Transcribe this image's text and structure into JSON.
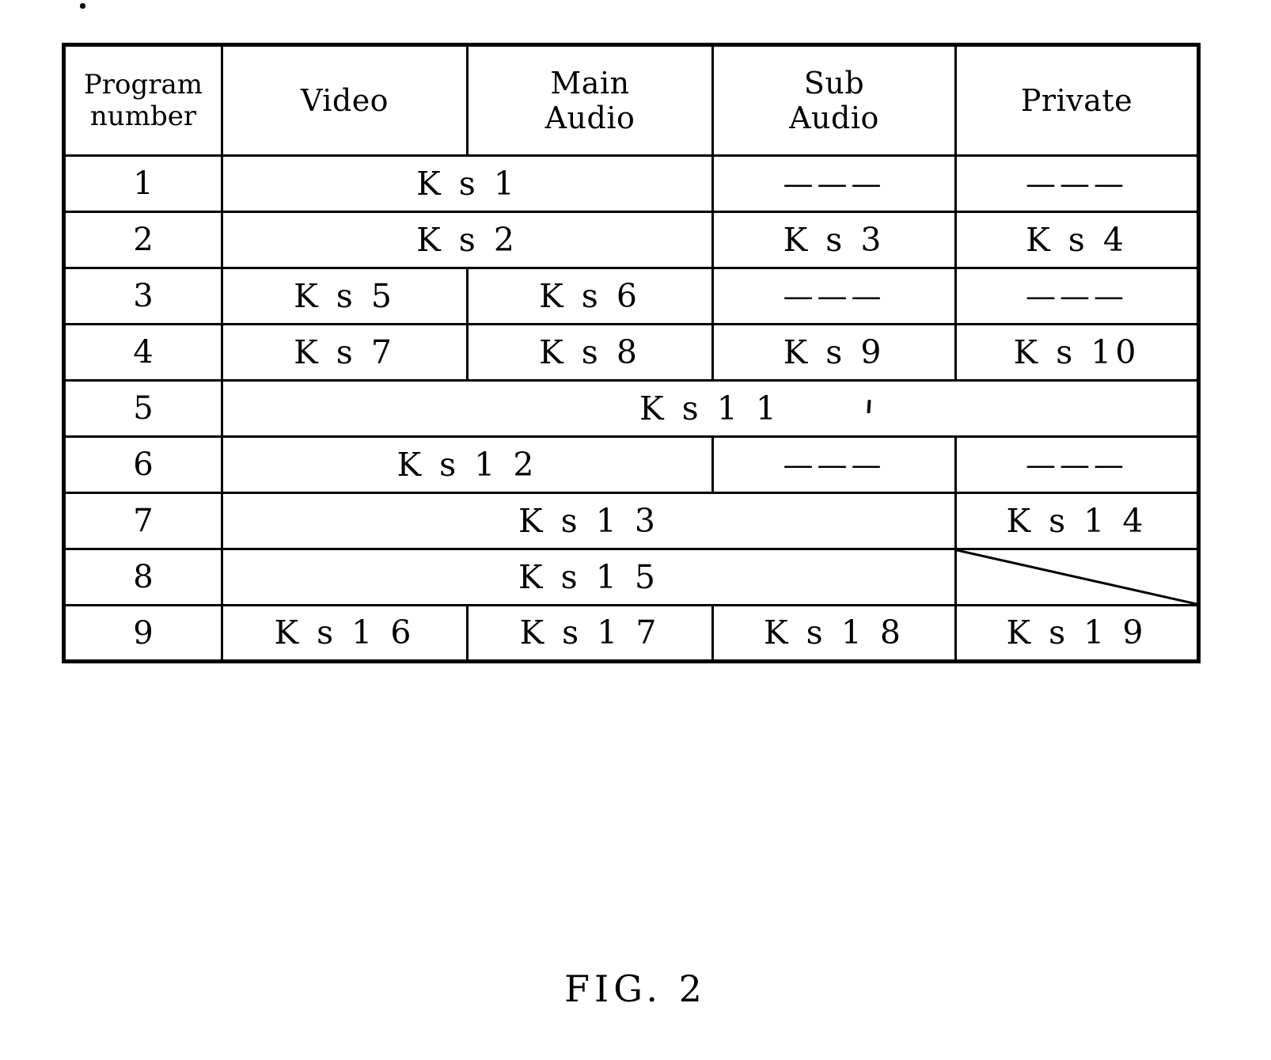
{
  "figure": {
    "caption": "FIG. 2"
  },
  "table": {
    "columns": [
      {
        "key": "program_number",
        "label_lines": [
          "Program",
          "number"
        ]
      },
      {
        "key": "video",
        "label_lines": [
          "Video"
        ]
      },
      {
        "key": "main_audio",
        "label_lines": [
          "Main",
          "Audio"
        ]
      },
      {
        "key": "sub_audio",
        "label_lines": [
          "Sub",
          "Audio"
        ]
      },
      {
        "key": "private",
        "label_lines": [
          "Private"
        ]
      }
    ],
    "empty_marker": "———",
    "rows": [
      {
        "program_number": "1",
        "cells": [
          {
            "text": "K s 1",
            "span": 2
          },
          {
            "text": "———",
            "span": 1
          },
          {
            "text": "———",
            "span": 1
          }
        ]
      },
      {
        "program_number": "2",
        "cells": [
          {
            "text": "K s 2",
            "span": 2
          },
          {
            "text": "K s 3",
            "span": 1
          },
          {
            "text": "K s 4",
            "span": 1
          }
        ]
      },
      {
        "program_number": "3",
        "cells": [
          {
            "text": "K s 5",
            "span": 1
          },
          {
            "text": "K s 6",
            "span": 1
          },
          {
            "text": "———",
            "span": 1
          },
          {
            "text": "———",
            "span": 1
          }
        ]
      },
      {
        "program_number": "4",
        "cells": [
          {
            "text": "K s 7",
            "span": 1
          },
          {
            "text": "K s 8",
            "span": 1
          },
          {
            "text": "K s 9",
            "span": 1
          },
          {
            "text": "K s 10",
            "span": 1
          }
        ]
      },
      {
        "program_number": "5",
        "cells": [
          {
            "text": "K s 1 1",
            "span": 4
          }
        ]
      },
      {
        "program_number": "6",
        "cells": [
          {
            "text": "K s 1 2",
            "span": 2
          },
          {
            "text": "———",
            "span": 1
          },
          {
            "text": "———",
            "span": 1
          }
        ]
      },
      {
        "program_number": "7",
        "cells": [
          {
            "text": "K s 1 3",
            "span": 3
          },
          {
            "text": "K s 1 4",
            "span": 1
          }
        ]
      },
      {
        "program_number": "8",
        "cells": [
          {
            "text": "K s 1 5",
            "span": 3
          },
          {
            "text": "",
            "span": 1,
            "diagonal": true
          }
        ]
      },
      {
        "program_number": "9",
        "cells": [
          {
            "text": "K s 1 6",
            "span": 1
          },
          {
            "text": "K s 1 7",
            "span": 1
          },
          {
            "text": "K s 1 8",
            "span": 1
          },
          {
            "text": "K s 1 9",
            "span": 1
          }
        ]
      }
    ]
  },
  "colors": {
    "ink": "#000000",
    "paper": "#ffffff"
  }
}
